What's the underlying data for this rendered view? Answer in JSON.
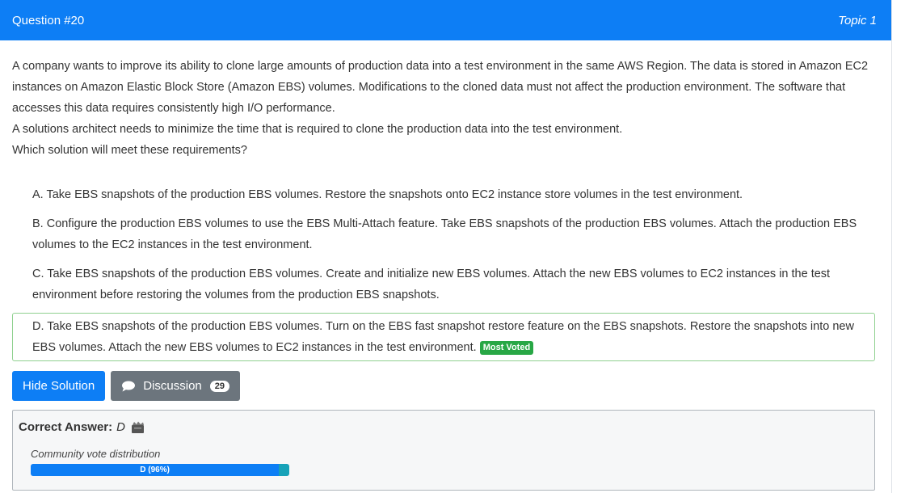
{
  "header": {
    "question_number": "Question #20",
    "topic": "Topic 1"
  },
  "question": {
    "paragraphs": [
      "A company wants to improve its ability to clone large amounts of production data into a test environment in the same AWS Region. The data is stored in Amazon EC2 instances on Amazon Elastic Block Store (Amazon EBS) volumes. Modifications to the cloned data must not affect the production environment. The software that accesses this data requires consistently high I/O performance.",
      "A solutions architect needs to minimize the time that is required to clone the production data into the test environment.",
      "Which solution will meet these requirements?"
    ]
  },
  "choices": [
    {
      "text": "A. Take EBS snapshots of the production EBS volumes. Restore the snapshots onto EC2 instance store volumes in the test environment."
    },
    {
      "text": "B. Configure the production EBS volumes to use the EBS Multi-Attach feature. Take EBS snapshots of the production EBS volumes. Attach the production EBS volumes to the EC2 instances in the test environment."
    },
    {
      "text": "C. Take EBS snapshots of the production EBS volumes. Create and initialize new EBS volumes. Attach the new EBS volumes to EC2 instances in the test environment before restoring the volumes from the production EBS snapshots."
    },
    {
      "text": "D. Take EBS snapshots of the production EBS volumes. Turn on the EBS fast snapshot restore feature on the EBS snapshots. Restore the snapshots into new EBS volumes. Attach the new EBS volumes to EC2 instances in the test environment.",
      "badge": "Most Voted"
    }
  ],
  "actions": {
    "hide_solution": "Hide Solution",
    "discussion": "Discussion",
    "discussion_count": "29"
  },
  "answer": {
    "label": "Correct Answer:",
    "value": "D",
    "vote_label": "Community vote distribution",
    "vote_text": "D (96%)",
    "vote_percent": 96
  },
  "colors": {
    "primary": "#0d7ef5",
    "secondary": "#6c757d",
    "success": "#28a745",
    "info": "#17a2b8"
  },
  "icons": {
    "discussion": "comment-icon",
    "reveal": "reveal-solution-icon"
  }
}
